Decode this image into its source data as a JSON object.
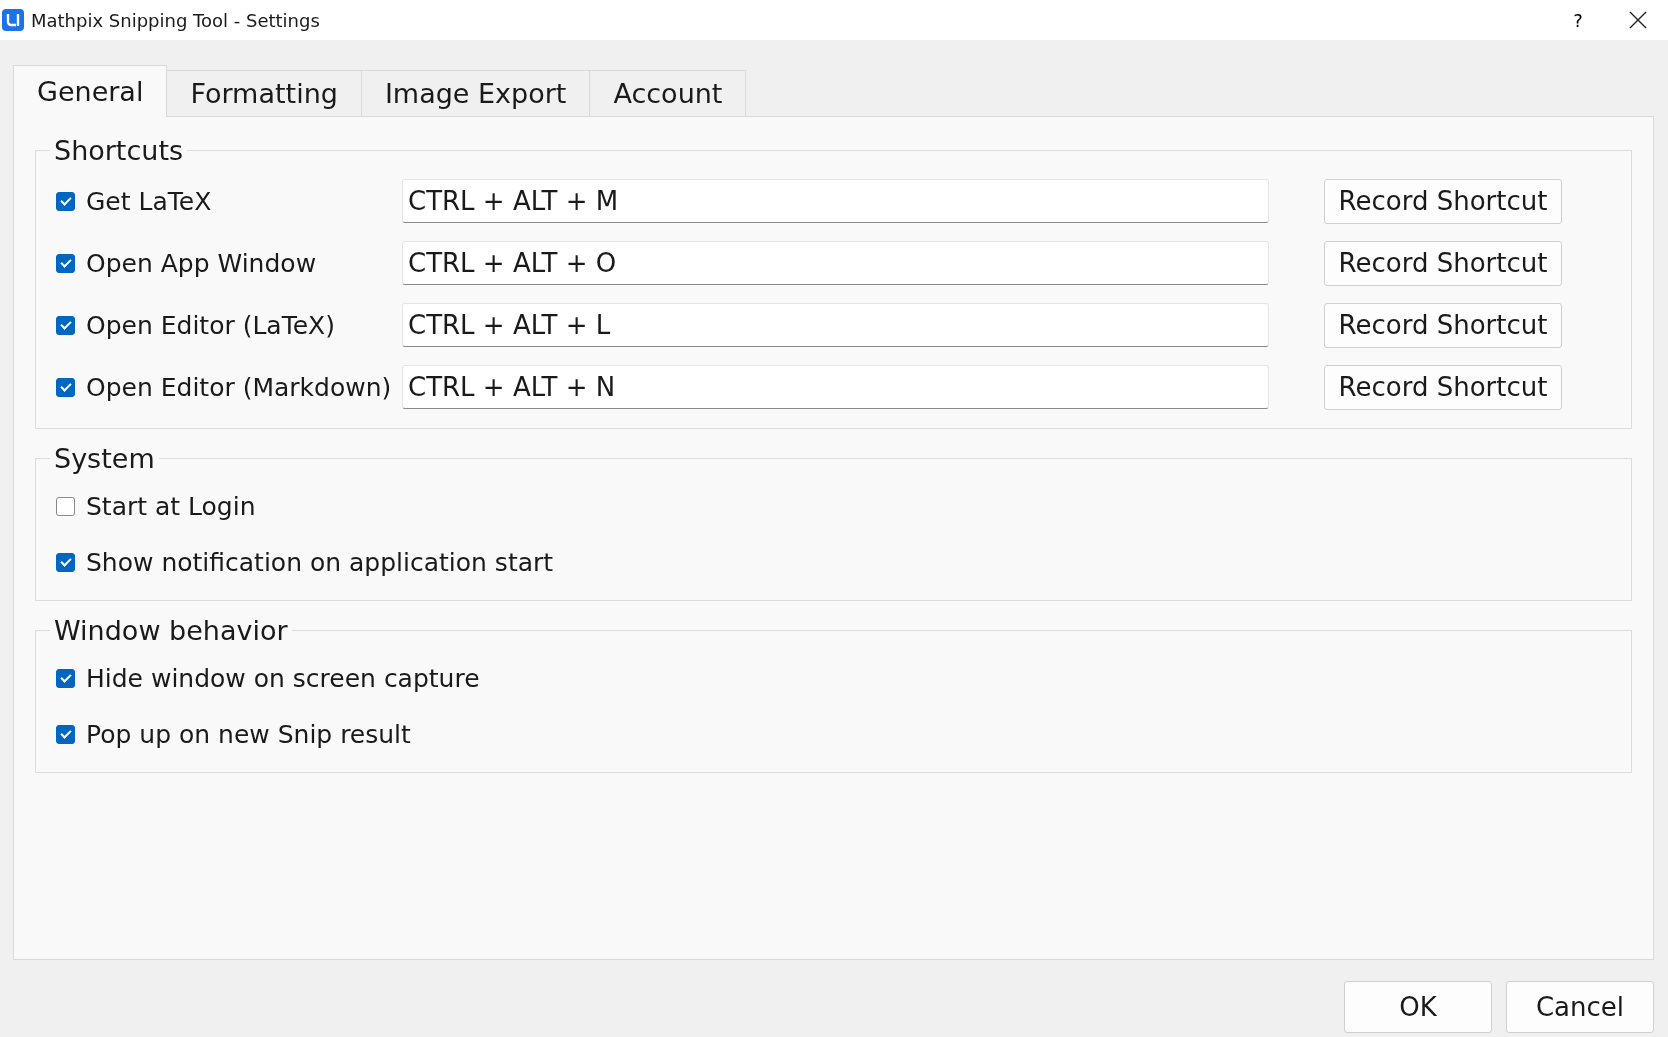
{
  "window": {
    "title": "Mathpix Snipping Tool - Settings",
    "help": "?"
  },
  "tabs": [
    {
      "label": "General",
      "selected": true
    },
    {
      "label": "Formatting",
      "selected": false
    },
    {
      "label": "Image Export",
      "selected": false
    },
    {
      "label": "Account",
      "selected": false
    }
  ],
  "shortcuts": {
    "title": "Shortcuts",
    "rows": [
      {
        "label": "Get LaTeX",
        "checked": true,
        "value": "CTRL + ALT + M",
        "button": "Record Shortcut"
      },
      {
        "label": "Open App Window",
        "checked": true,
        "value": "CTRL + ALT + O",
        "button": "Record Shortcut"
      },
      {
        "label": "Open Editor (LaTeX)",
        "checked": true,
        "value": "CTRL + ALT + L",
        "button": "Record Shortcut"
      },
      {
        "label": "Open Editor (Markdown)",
        "checked": true,
        "value": "CTRL + ALT + N",
        "button": "Record Shortcut"
      }
    ]
  },
  "groups": [
    {
      "title": "System",
      "options": [
        {
          "label": "Start at Login",
          "checked": false
        },
        {
          "label": "Show notification on application start",
          "checked": true
        }
      ]
    },
    {
      "title": "Window behavior",
      "options": [
        {
          "label": "Hide window on screen capture",
          "checked": true
        },
        {
          "label": "Pop up on new Snip result",
          "checked": true
        }
      ]
    }
  ],
  "buttons": [
    "OK",
    "Cancel"
  ]
}
